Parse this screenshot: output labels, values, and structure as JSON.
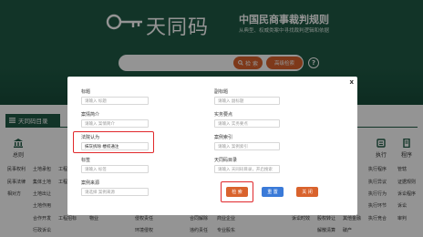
{
  "header": {
    "brand_name": "天同码",
    "brand_title": "中国民商事裁判规则",
    "brand_subtitle": "从典型、权威类案中寻找裁判逻辑和依据",
    "search_button": "检 索",
    "advanced_button": "高级检索",
    "help_symbol": "?"
  },
  "directory": {
    "tab_label": "天同码目录"
  },
  "categories": {
    "left": "总则",
    "right1": "执行",
    "right2": "程序"
  },
  "background_rows": {
    "col1": [
      "民事权利",
      "民事法律",
      "相对方"
    ],
    "col2": [
      "土地承包",
      "集体土地",
      "土地出让",
      "土地作用",
      "合作开发",
      "行政诉讼"
    ],
    "col3": [
      "工程建设",
      "工程",
      "工程招标"
    ],
    "col4": [
      "物业"
    ],
    "col5": [
      "侵权责任",
      "环境侵权"
    ],
    "col6": [
      "合同解除",
      "违约责任"
    ],
    "col7": [
      "商业企业",
      "专业股东"
    ],
    "col8": [
      "诉讼时效"
    ],
    "col9": [
      "股权转让",
      "解散清算"
    ],
    "col10": [
      "其他金融",
      "破产"
    ],
    "col11": [
      "执行程序",
      "执行异议",
      "执行行为",
      "执行环节",
      "执行竞合"
    ],
    "col12": [
      "管辖",
      "证据规则",
      "诉讼程序",
      "诉讼",
      "审判"
    ]
  },
  "modal": {
    "close_symbol": "x",
    "fields_left": [
      {
        "label": "标题",
        "placeholder": "请输入 标题",
        "value": ""
      },
      {
        "label": "案情简介",
        "placeholder": "请输入 案情简介",
        "value": ""
      },
      {
        "label": "法院认为",
        "placeholder": "",
        "value": "抹灰拆除 楼权通注"
      },
      {
        "label": "标签",
        "placeholder": "请输入 标签",
        "value": ""
      },
      {
        "label": "案例来源",
        "placeholder": "请选择 案例来源",
        "value": ""
      }
    ],
    "fields_right": [
      {
        "label": "副标题",
        "placeholder": "请输入 副标题",
        "value": ""
      },
      {
        "label": "实务要点",
        "placeholder": "请输入 实务要点",
        "value": ""
      },
      {
        "label": "案例索引",
        "placeholder": "请输入 案例索引",
        "value": ""
      },
      {
        "label": "天同码目录",
        "placeholder": "请输入 天同码目录，开启搜索",
        "value": ""
      }
    ],
    "buttons": {
      "search": "检 索",
      "reset": "重 置",
      "close": "关 闭"
    }
  },
  "colors": {
    "brand_green": "#1f5a45",
    "accent_orange": "#d9632d",
    "highlight_red": "#e0282b",
    "reset_blue": "#3a7ad8"
  }
}
